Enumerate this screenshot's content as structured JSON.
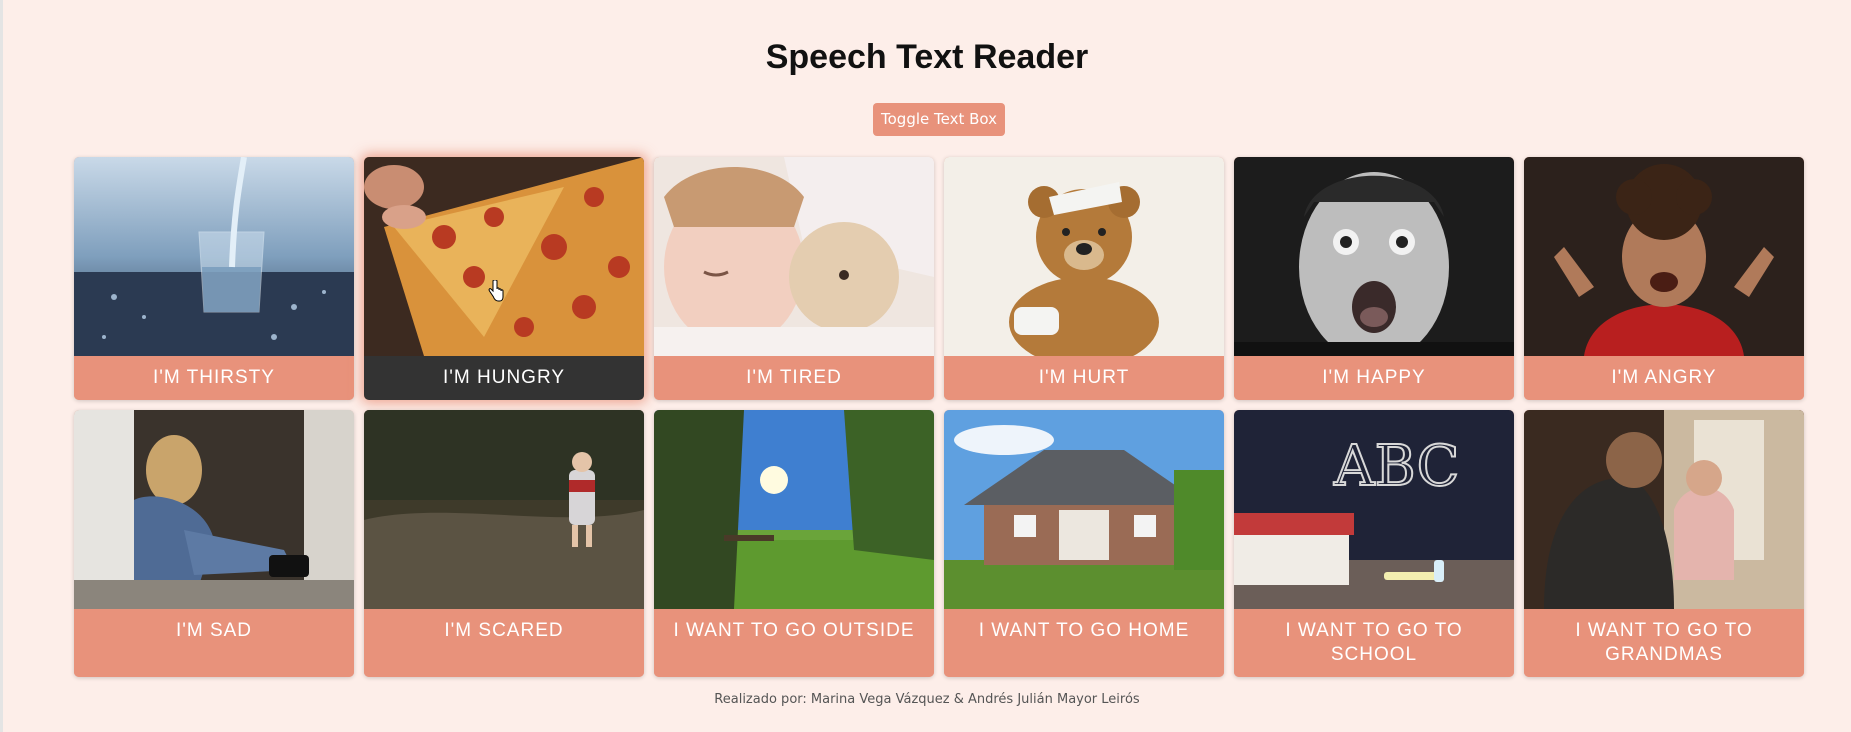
{
  "header": {
    "title": "Speech Text Reader",
    "toggle_label": "Toggle Text Box"
  },
  "cards": [
    {
      "label": "I'M THIRSTY",
      "image": "glass-of-water-image"
    },
    {
      "label": "I'M HUNGRY",
      "image": "pizza-image",
      "active": true
    },
    {
      "label": "I'M TIRED",
      "image": "sleeping-child-image"
    },
    {
      "label": "I'M HURT",
      "image": "bandaged-teddy-bear-image"
    },
    {
      "label": "I'M HAPPY",
      "image": "excited-boy-image"
    },
    {
      "label": "I'M ANGRY",
      "image": "angry-boy-image"
    },
    {
      "label": "I'M SAD",
      "image": "sad-child-image"
    },
    {
      "label": "I'M SCARED",
      "image": "child-in-forest-image"
    },
    {
      "label": "I WANT TO GO OUTSIDE",
      "image": "sunny-park-image"
    },
    {
      "label": "I WANT TO GO HOME",
      "image": "house-image"
    },
    {
      "label": "I WANT TO GO TO SCHOOL",
      "image": "chalkboard-abc-image"
    },
    {
      "label": "I WANT TO GO TO GRANDMAS",
      "image": "grandma-and-child-image"
    }
  ],
  "footer": {
    "credits": "Realizado por: Marina Vega Vázquez & Andrés Julián Mayor Leirós"
  },
  "colors": {
    "background": "#fdeee9",
    "accent": "#e8927b",
    "active_label": "#333333"
  }
}
